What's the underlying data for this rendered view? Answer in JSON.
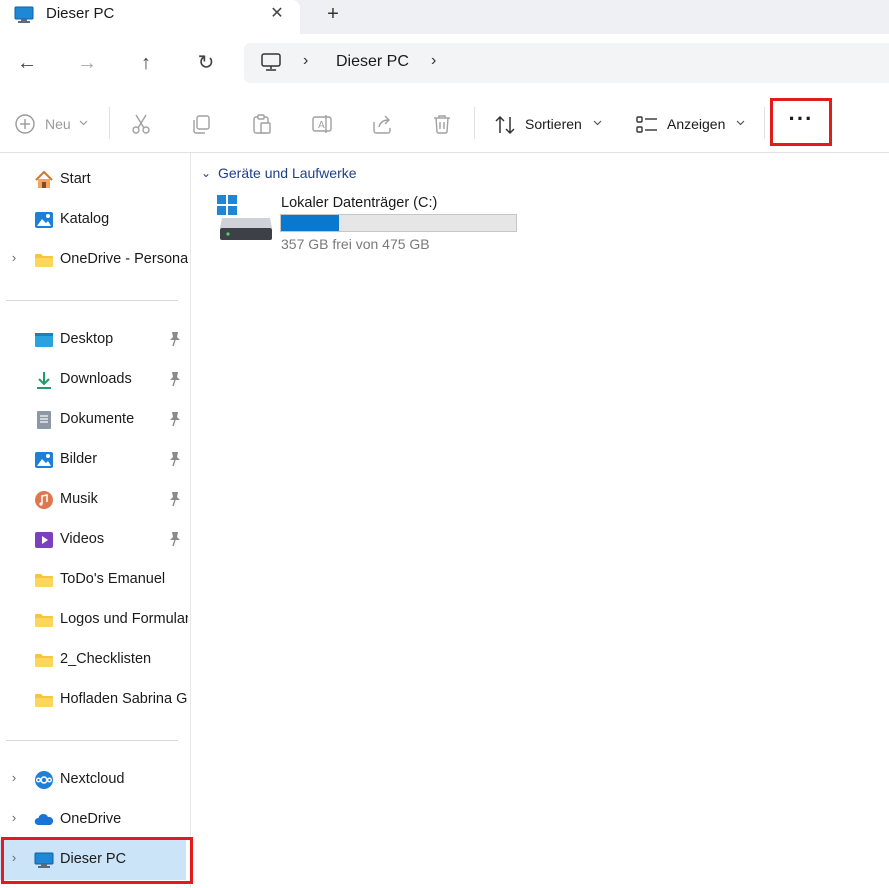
{
  "tab": {
    "title": "Dieser PC",
    "close_glyph": "✕",
    "new_glyph": "+"
  },
  "nav": {
    "back_glyph": "←",
    "forward_glyph": "→",
    "up_glyph": "↑",
    "refresh_glyph": "↻",
    "breadcrumb": "Dieser PC",
    "sep": "›"
  },
  "toolbar": {
    "new_label": "Neu",
    "sort_label": "Sortieren",
    "view_label": "Anzeigen",
    "more_glyph": "···"
  },
  "sidebar": {
    "top": [
      {
        "label": "Start",
        "icon": "home-icon"
      },
      {
        "label": "Katalog",
        "icon": "gallery-icon"
      },
      {
        "label": "OneDrive - Personal",
        "icon": "folder-icon",
        "expandable": true
      }
    ],
    "pinned": [
      {
        "label": "Desktop",
        "icon": "desktop-icon",
        "pinned": true
      },
      {
        "label": "Downloads",
        "icon": "download-icon",
        "pinned": true
      },
      {
        "label": "Dokumente",
        "icon": "document-icon",
        "pinned": true
      },
      {
        "label": "Bilder",
        "icon": "pictures-icon",
        "pinned": true
      },
      {
        "label": "Musik",
        "icon": "music-icon",
        "pinned": true
      },
      {
        "label": "Videos",
        "icon": "video-icon",
        "pinned": true
      },
      {
        "label": "ToDo's Emanuel",
        "icon": "folder-icon"
      },
      {
        "label": "Logos und Formulare",
        "icon": "folder-icon"
      },
      {
        "label": "2_Checklisten",
        "icon": "folder-icon"
      },
      {
        "label": "Hofladen Sabrina G",
        "icon": "folder-icon"
      }
    ],
    "bottom": [
      {
        "label": "Nextcloud",
        "icon": "nextcloud-icon"
      },
      {
        "label": "OneDrive",
        "icon": "onedrive-icon"
      },
      {
        "label": "Dieser PC",
        "icon": "pc-icon",
        "selected": true
      }
    ],
    "chevron": "›"
  },
  "content": {
    "group_title": "Geräte und Laufwerke",
    "group_chevron": "⌄",
    "drive": {
      "name": "Lokaler Datenträger (C:)",
      "free_text": "357 GB frei von 475 GB",
      "used_fraction": 0.248
    }
  },
  "colors": {
    "accent": "#0b78d0",
    "selection": "#cce4f7",
    "highlight": "#e31b1b",
    "group_text": "#1f3f8a"
  }
}
